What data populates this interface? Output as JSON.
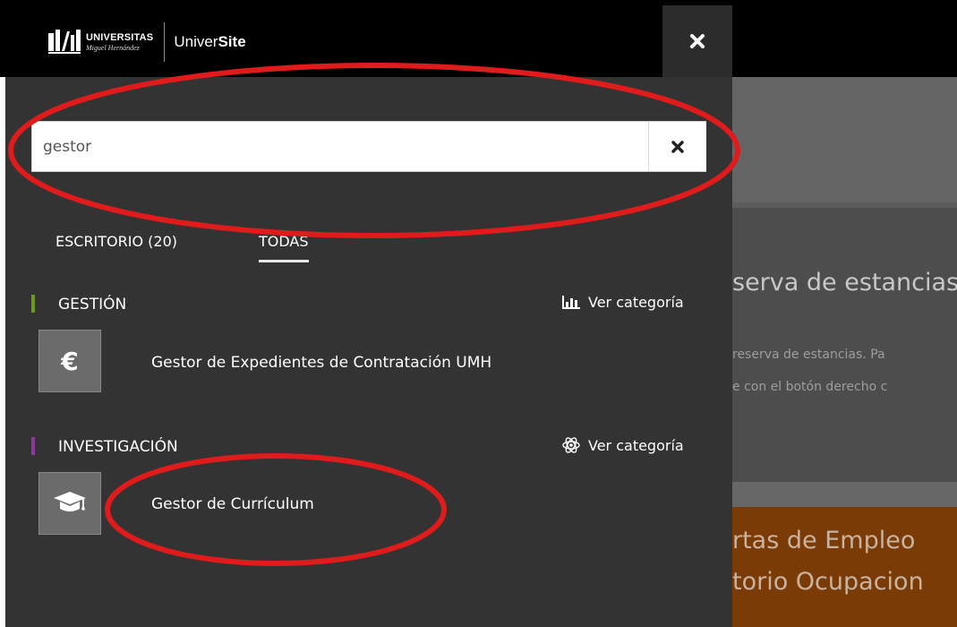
{
  "header": {
    "logo_line1": "UNIVERSITAS",
    "logo_line2": "Miguel Hernández",
    "app_name_prefix": "Univer",
    "app_name_suffix": "Site",
    "close_icon": "close-icon"
  },
  "search": {
    "value": "gestor",
    "clear_icon": "close-icon"
  },
  "tabs": [
    {
      "label": "ESCRITORIO (20)",
      "active": false
    },
    {
      "label": "TODAS",
      "active": true
    }
  ],
  "sections": [
    {
      "title": "GESTIÓN",
      "accent_color": "#6a9a1f",
      "category_link": "Ver categoría",
      "category_icon": "bar-chart-icon",
      "items": [
        {
          "name": "Gestor de Expedientes de Contratación UMH",
          "icon": "euro-icon"
        }
      ]
    },
    {
      "title": "INVESTIGACIÓN",
      "accent_color": "#8b3a9c",
      "category_link": "Ver categoría",
      "category_icon": "atom-icon",
      "items": [
        {
          "name": "Gestor de Currículum",
          "icon": "graduation-cap-icon"
        }
      ]
    }
  ],
  "background": {
    "title": "serva de estancias",
    "line1": "reserva de estancias. Pa",
    "line2": "e con el botón derecho c",
    "orange_line1": "rtas de Empleo",
    "orange_line2": "torio Ocupacion"
  },
  "colors": {
    "panel_bg": "#333333",
    "header_bg": "#000000",
    "annotation": "#e01b1b",
    "orange_card": "#7a3b07"
  }
}
